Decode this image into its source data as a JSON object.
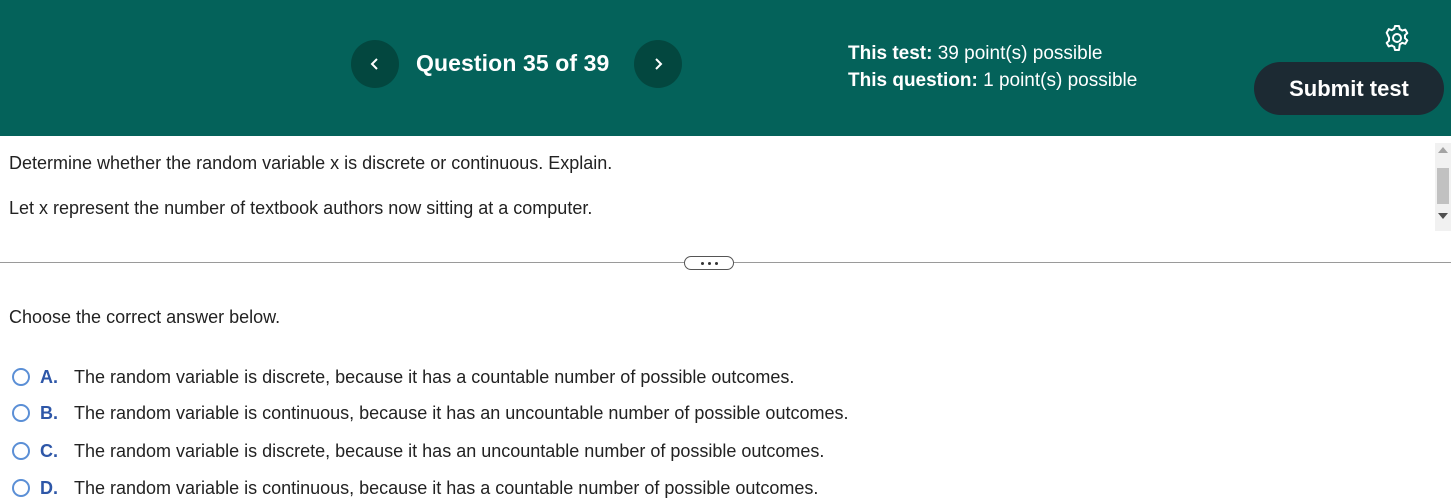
{
  "header": {
    "question_title": "Question 35 of 39",
    "test_label": "This test:",
    "test_value": " 39 point(s) possible",
    "question_label": "This question:",
    "question_value": " 1 point(s) possible",
    "submit_label": "Submit test"
  },
  "question": {
    "prompt": "Determine whether the random variable x is discrete or continuous. Explain.",
    "detail": "Let x represent the number of textbook authors now sitting at a computer."
  },
  "answer": {
    "instruction": "Choose the correct answer below.",
    "options": [
      {
        "letter": "A.",
        "text": "The random variable is discrete, because it has a countable number of possible outcomes."
      },
      {
        "letter": "B.",
        "text": "The random variable is continuous, because it has an uncountable number of possible outcomes."
      },
      {
        "letter": "C.",
        "text": "The random variable is discrete, because it has an uncountable number of possible outcomes."
      },
      {
        "letter": "D.",
        "text": "The random variable is continuous, because it has a countable number of possible outcomes."
      }
    ]
  },
  "colors": {
    "header_bg": "#04625a",
    "nav_btn": "#03473f",
    "submit_bg": "#1c2a33",
    "option_letter": "#2e57a8",
    "radio": "#5b8fd6"
  },
  "icons": {
    "prev": "chevron-left-icon",
    "next": "chevron-right-icon",
    "settings": "gear-icon",
    "more": "ellipsis-icon"
  }
}
